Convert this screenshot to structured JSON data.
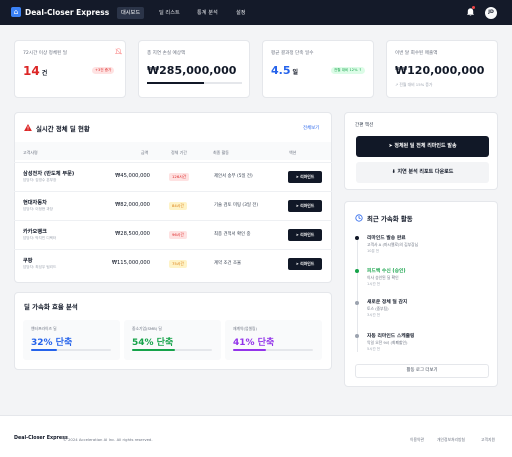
{
  "app": {
    "name": "Deal-Closer Express"
  },
  "nav": {
    "tabs": [
      {
        "label": "대시보드",
        "active": true
      },
      {
        "label": "딜 리스트",
        "active": false
      },
      {
        "label": "통계 분석",
        "active": false
      },
      {
        "label": "설정",
        "active": false
      }
    ],
    "avatar_initials": "JD"
  },
  "kpis": [
    {
      "label": "72시간 이상 정체된 딜",
      "value": "14",
      "unit": "건",
      "badge": "+3건 증가",
      "color": "#dc2626"
    },
    {
      "label": "총 지연 손실 예상액",
      "value": "₩285,000,000",
      "progress": 0.6
    },
    {
      "label": "평균 결과정 단축 일수",
      "value": "4.5",
      "unit": "일",
      "badge": "전월 대비 12% ↑",
      "color": "#2563eb"
    },
    {
      "label": "이번 달 회수된 매출액",
      "value": "₩120,000,000",
      "trend": "전월 대비 15% 증가"
    }
  ],
  "stalled": {
    "title": "실시간 정체 딜 현황",
    "view_all": "전체보기",
    "columns": [
      "고객사명",
      "금액",
      "정체 기간",
      "최종 활동",
      "액션"
    ],
    "rows": [
      {
        "name": "삼성전자 (반도체 부문)",
        "sub": "담당자: 김영수 본부장",
        "amount": "₩45,000,000",
        "stall": "126시간",
        "activity": "제안서 송부 (5일 전)",
        "action": "리마인드"
      },
      {
        "name": "현대자동차",
        "sub": "담당자: 이정현 과장",
        "amount": "₩82,000,000",
        "stall": "84시간",
        "activity": "기술 검토 미팅 (3일 전)",
        "action": "리마인드"
      },
      {
        "name": "카카오뱅크",
        "sub": "담당자: 박지민 디렉터",
        "amount": "₩28,500,000",
        "stall": "96시간",
        "activity": "최종 견적서 확인 중",
        "action": "리마인드"
      },
      {
        "name": "쿠팡",
        "sub": "담당자: 최성우 팀리드",
        "amount": "₩115,000,000",
        "stall": "75시간",
        "activity": "계약 조건 조율",
        "action": "리마인드"
      }
    ]
  },
  "efficiency": {
    "title": "딜 가속화 효율 분석",
    "items": [
      {
        "label": "엔터프라이즈 딜",
        "value": "32% 단축",
        "fill": 0.32,
        "color": "#2563eb"
      },
      {
        "label": "중소기업(SMB) 딜",
        "value": "54% 단축",
        "fill": 0.54,
        "color": "#16a34a"
      },
      {
        "label": "재계약(업셀링)",
        "value": "41% 단축",
        "fill": 0.41,
        "color": "#9333ea"
      }
    ]
  },
  "quick_actions": {
    "title": "간편 액션",
    "primary": "정체된 딜 전체 리마인드 발송",
    "secondary": "지연 분석 리포트 다운로드"
  },
  "activity": {
    "title": "최근 가속화 활동",
    "items": [
      {
        "title": "리마인드 발송 완료",
        "sub": "고객사 A (마시멜로)의 김부장님",
        "time": "10분 전",
        "color": "#111827"
      },
      {
        "title": "피드백 수신 (승인)",
        "sub": "이사 승인된 딜 확인",
        "time": "1시간 전",
        "color": "#16a34a",
        "title_color": "#16a34a"
      },
      {
        "title": "새로운 정체 딜 감지",
        "sub": "토스 (중부팀)",
        "time": "3시간 전",
        "color": "#9ca3af"
      },
      {
        "title": "자동 리마인드 스케줄링",
        "sub": "익일 오전 9시 (화폐할인)",
        "time": "5시간 전",
        "color": "#9ca3af"
      }
    ],
    "more": "활동 로그 더보기"
  },
  "footer": {
    "brand": "Deal-Closer Express",
    "copy": "© 2024 Acceleration AI Inc. All rights reserved.",
    "links": [
      "이용약관",
      "개인정보처리방침",
      "고객지원"
    ]
  }
}
